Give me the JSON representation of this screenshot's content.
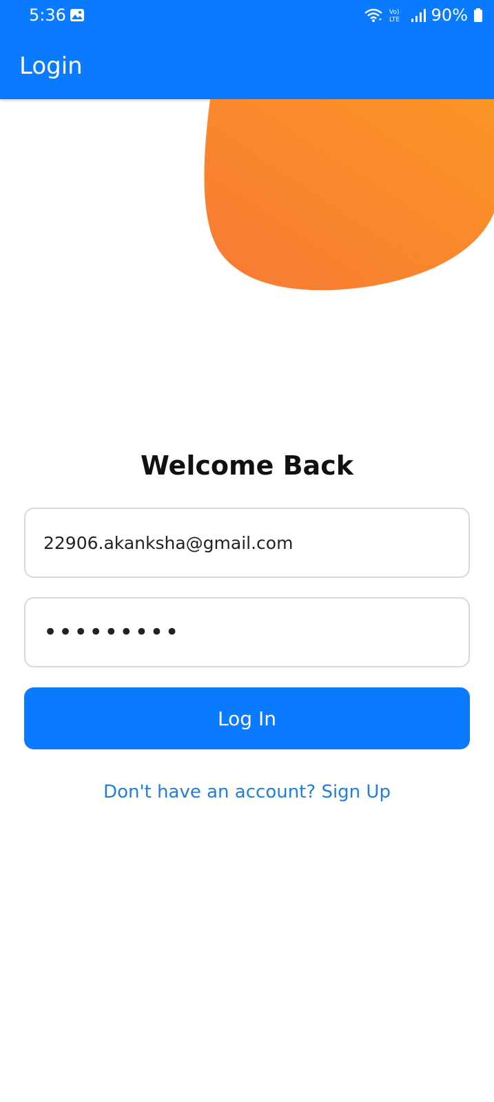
{
  "status_bar": {
    "time": "5:36",
    "battery": "90%",
    "icons": [
      "gallery-icon",
      "wifi-icon",
      "volte-icon",
      "signal-icon",
      "battery-icon"
    ]
  },
  "app_bar": {
    "title": "Login"
  },
  "colors": {
    "primary": "#0A7BFF",
    "blob_start": "#F87A35",
    "blob_end": "#FB9526",
    "link": "#1E7FDC"
  },
  "form": {
    "heading": "Welcome Back",
    "email_value": "22906.akanksha@gmail.com",
    "password_value": "•••••••••",
    "login_label": "Log In",
    "signup_text": "Don't have an account? Sign Up"
  }
}
